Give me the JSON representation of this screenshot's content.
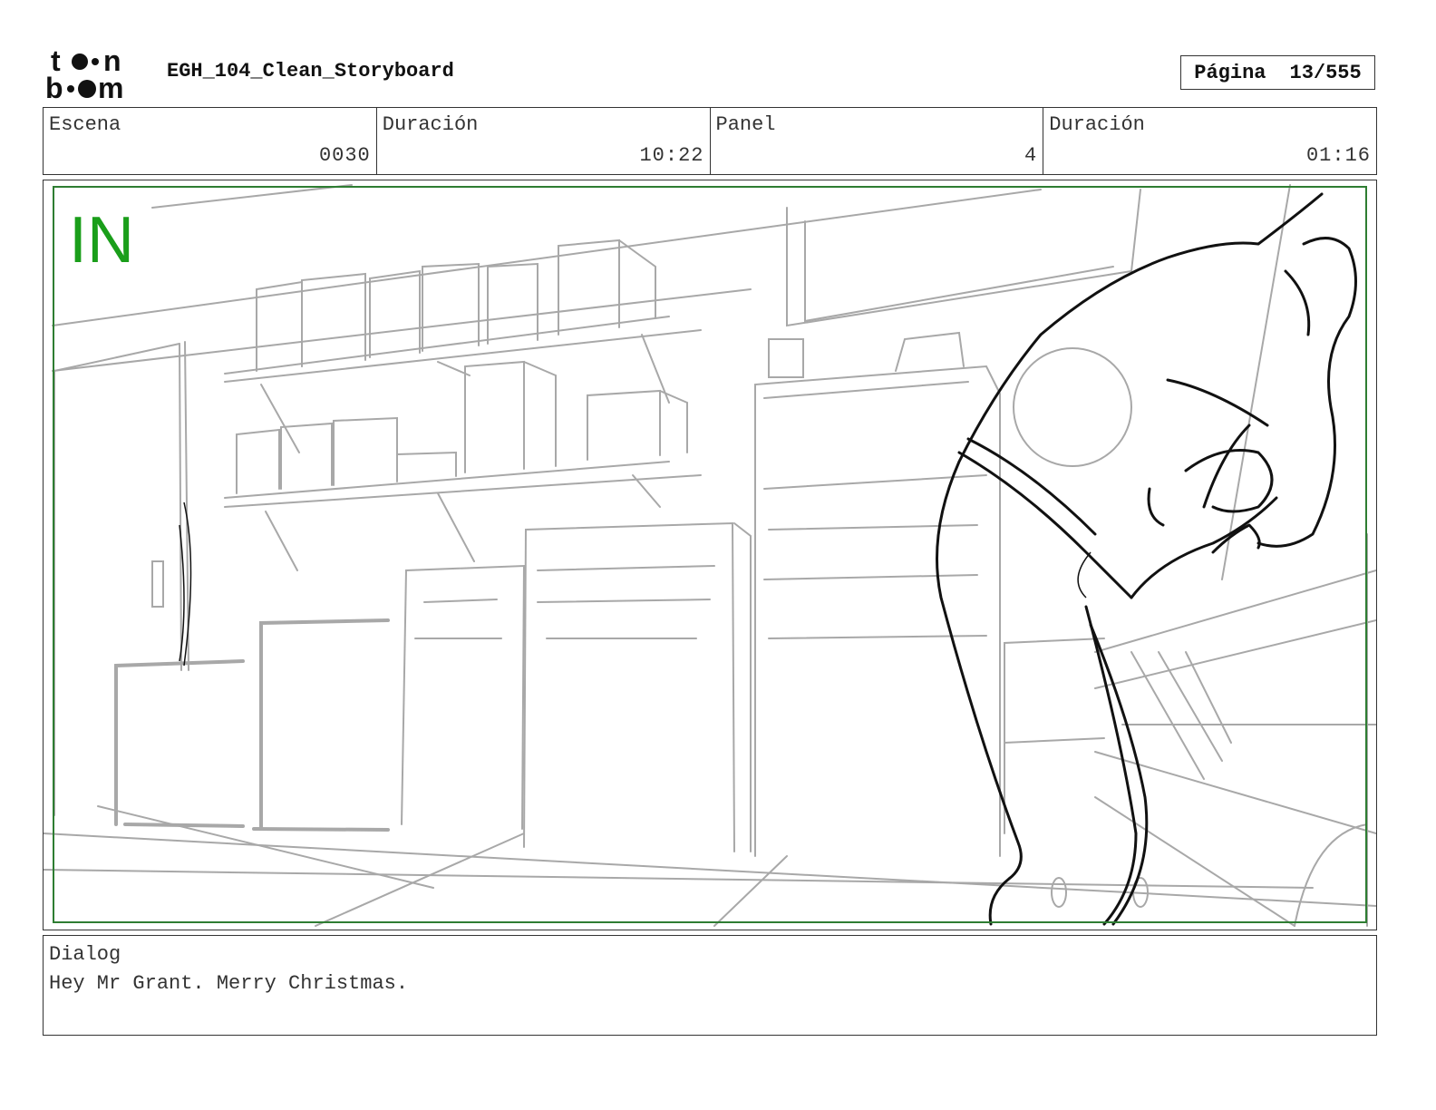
{
  "header": {
    "logo_text": "toon boom",
    "document_title": "EGH_104_Clean_Storyboard",
    "page_label": "Página",
    "page_value": "13/555"
  },
  "info": {
    "scene_label": "Escena",
    "scene_value": "0030",
    "scene_duration_label": "Duración",
    "scene_duration_value": "10:22",
    "panel_label": "Panel",
    "panel_value": "4",
    "panel_duration_label": "Duración",
    "panel_duration_value": "01:16"
  },
  "panel": {
    "marker_text": "IN",
    "marker_color": "#1a9e1a",
    "frame_color": "#2e7d32"
  },
  "dialog": {
    "label": "Dialog",
    "text": "Hey Mr Grant. Merry Christmas."
  }
}
